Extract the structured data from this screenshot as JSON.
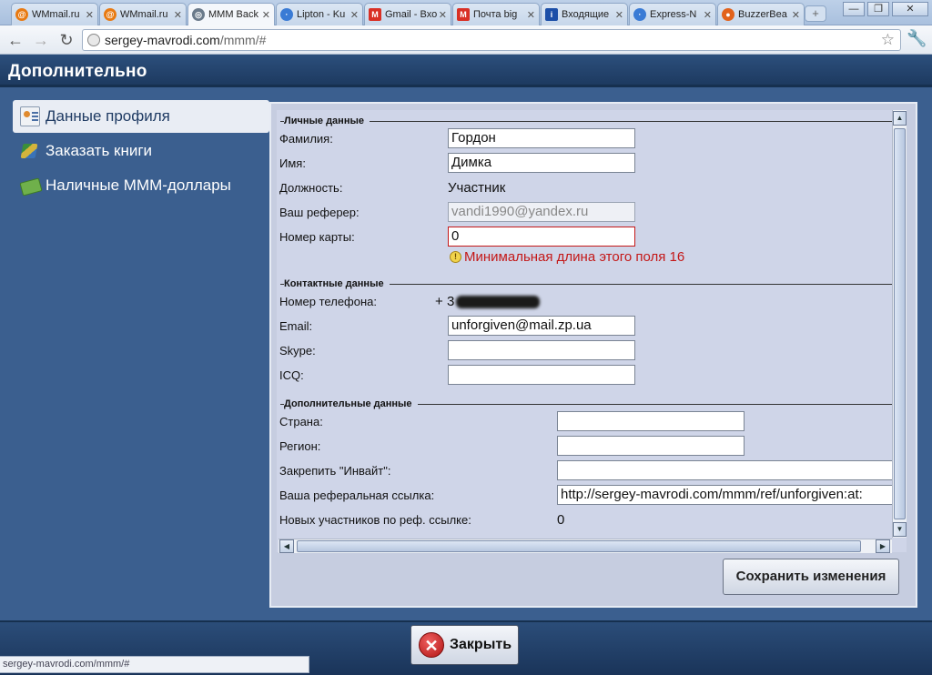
{
  "browser": {
    "tabs": [
      {
        "label": "WMmail.ru",
        "icon": "at-icon",
        "color": "#e87a12"
      },
      {
        "label": "WMmail.ru",
        "icon": "at-icon",
        "color": "#e87a12"
      },
      {
        "label": "МММ Back",
        "icon": "globe-icon",
        "color": "#6a7a8a"
      },
      {
        "label": "Lipton - Ku",
        "icon": "loading-icon",
        "color": "#3a7bd5"
      },
      {
        "label": "Gmail - Вхо",
        "icon": "gmail-icon",
        "color": "#d93025"
      },
      {
        "label": "Почта big",
        "icon": "gmail-icon",
        "color": "#d93025"
      },
      {
        "label": "Входящие",
        "icon": "info-icon",
        "color": "#1c4fa8"
      },
      {
        "label": "Express-N",
        "icon": "loading-icon",
        "color": "#3a7bd5"
      },
      {
        "label": "BuzzerBea",
        "icon": "ball-icon",
        "color": "#e2621b"
      }
    ],
    "url_host": "sergey-mavrodi.com",
    "url_path": "/mmm/#",
    "status_url": "sergey-mavrodi.com/mmm/#"
  },
  "page": {
    "title": "Дополнительно",
    "menu": [
      {
        "label": "Данные профиля",
        "icon": "profile-card-icon"
      },
      {
        "label": "Заказать книги",
        "icon": "books-icon"
      },
      {
        "label": "Наличные МММ-доллары",
        "icon": "money-icon"
      }
    ]
  },
  "form": {
    "personal_legend": "Личные данные",
    "surname_label": "Фамилия:",
    "surname_value": "Гордон",
    "name_label": "Имя:",
    "name_value": "Димка",
    "position_label": "Должность:",
    "position_value": "Участник",
    "referer_label": "Ваш реферер:",
    "referer_value": "vandi1990@yandex.ru",
    "card_label": "Номер карты:",
    "card_value": "0",
    "card_error": "Минимальная длина этого поля 16",
    "contact_legend": "Контактные данные",
    "phone_label": "Номер телефона:",
    "phone_prefix": "+",
    "phone_value": "3",
    "email_label": "Email:",
    "email_value": "unforgiven@mail.zp.ua",
    "skype_label": "Skype:",
    "skype_value": "",
    "icq_label": "ICQ:",
    "icq_value": "",
    "extra_legend": "Дополнительные данные",
    "country_label": "Страна:",
    "country_value": "",
    "region_label": "Регион:",
    "region_value": "",
    "invite_label": "Закрепить \"Инвайт\":",
    "invite_value": "",
    "reflink_label": "Ваша реферальная ссылка:",
    "reflink_value": "http://sergey-mavrodi.com/mmm/ref/unforgiven:at:",
    "newmembers_label": "Новых участников по реф. ссылке:",
    "newmembers_value": "0"
  },
  "buttons": {
    "save": "Сохранить изменения",
    "close": "Закрыть"
  }
}
